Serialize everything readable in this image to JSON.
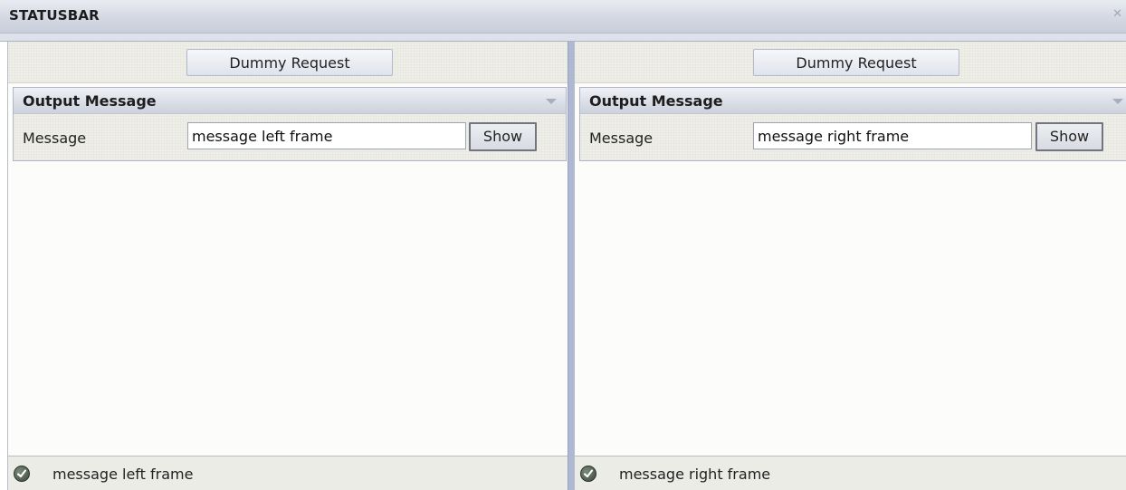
{
  "window": {
    "title": "STATUSBAR",
    "close_glyph": "✕"
  },
  "frames": [
    {
      "dummy_button_label": "Dummy Request",
      "panel_title": "Output Message",
      "message_label": "Message",
      "message_value": "message left frame",
      "show_label": "Show",
      "status_text": "message left frame",
      "status_icon": "check-circle-icon"
    },
    {
      "dummy_button_label": "Dummy Request",
      "panel_title": "Output Message",
      "message_label": "Message",
      "message_value": "message right frame",
      "show_label": "Show",
      "status_text": "message right frame",
      "status_icon": "check-circle-icon"
    }
  ],
  "colors": {
    "titlebar": "#d4d8e3",
    "splitter": "#aeb8d3",
    "frame_background": "#fcfcfa"
  }
}
